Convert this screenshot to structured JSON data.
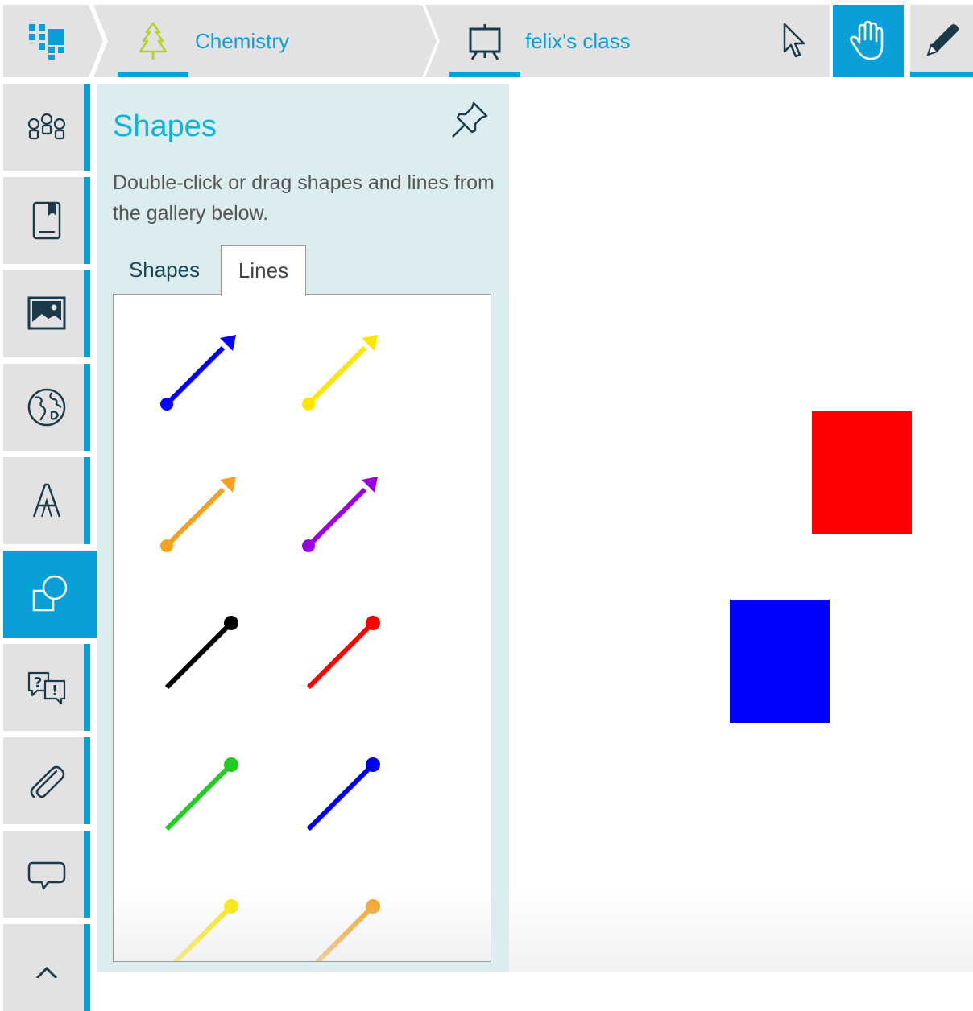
{
  "breadcrumb": {
    "subject": "Chemistry",
    "class_name": "felix's class"
  },
  "toolbar": {
    "select_tool": "pointer-icon",
    "pan_tool": "hand-icon",
    "pen_tool": "pen-icon",
    "active_tool": "pan"
  },
  "sidebar": {
    "items": [
      {
        "icon": "people-icon"
      },
      {
        "icon": "bookmark-book-icon"
      },
      {
        "icon": "image-icon"
      },
      {
        "icon": "globe-icon"
      },
      {
        "icon": "text-icon"
      },
      {
        "icon": "shapes-icon",
        "active": true
      },
      {
        "icon": "question-answer-icon"
      },
      {
        "icon": "paperclip-icon"
      },
      {
        "icon": "speech-bubble-icon"
      },
      {
        "icon": "chevron-up-icon"
      }
    ]
  },
  "panel": {
    "title": "Shapes",
    "description": "Double-click or drag shapes and lines from the gallery below.",
    "tabs": [
      {
        "label": "Shapes",
        "selected": false
      },
      {
        "label": "Lines",
        "selected": true
      }
    ],
    "lines": [
      {
        "color": "#0000ff",
        "style": "arrow"
      },
      {
        "color": "#ffe600",
        "style": "arrow"
      },
      {
        "color": "#f5a020",
        "style": "arrow"
      },
      {
        "color": "#9900dd",
        "style": "arrow"
      },
      {
        "color": "#000000",
        "style": "line"
      },
      {
        "color": "#ff0000",
        "style": "line"
      },
      {
        "color": "#22cc22",
        "style": "line"
      },
      {
        "color": "#0000ee",
        "style": "line"
      },
      {
        "color": "#ffe600",
        "style": "line"
      },
      {
        "color": "#f5a020",
        "style": "line"
      }
    ]
  },
  "canvas": {
    "shapes": [
      {
        "type": "rectangle",
        "color": "#ff0000"
      },
      {
        "type": "rectangle",
        "color": "#0000ff"
      }
    ]
  },
  "colors": {
    "accent": "#0a9fd8",
    "panel_bg": "#dcedf0",
    "title": "#13b3d6"
  }
}
